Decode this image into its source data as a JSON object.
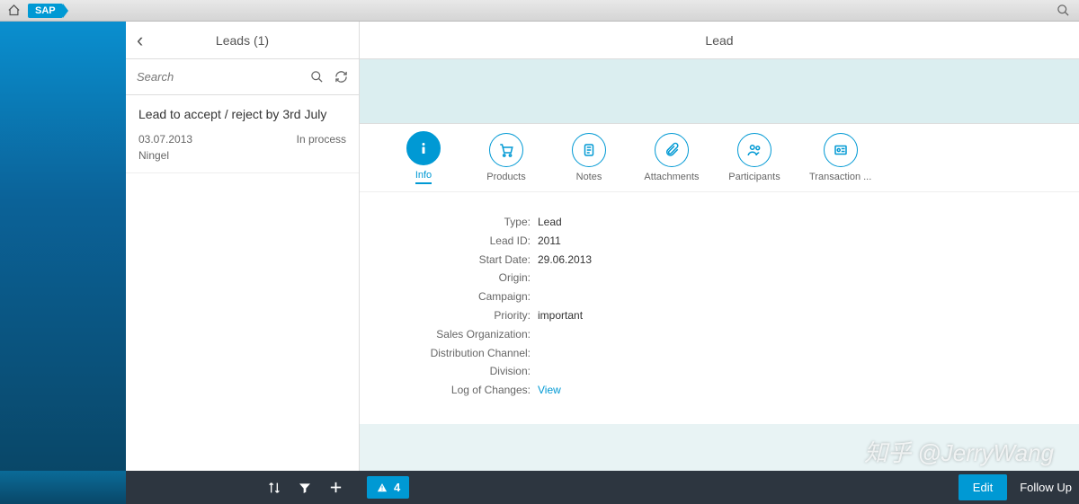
{
  "topbar": {
    "logo": "SAP"
  },
  "master": {
    "title": "Leads (1)",
    "search_placeholder": "Search",
    "item": {
      "title": "Lead to accept / reject by 3rd July",
      "date": "03.07.2013",
      "status": "In process",
      "owner": "Ningel"
    }
  },
  "detail": {
    "title": "Lead",
    "tabs": {
      "info": "Info",
      "products": "Products",
      "notes": "Notes",
      "attachments": "Attachments",
      "participants": "Participants",
      "transaction": "Transaction ..."
    },
    "info": {
      "labels": {
        "type": "Type:",
        "lead_id": "Lead ID:",
        "start_date": "Start Date:",
        "origin": "Origin:",
        "campaign": "Campaign:",
        "priority": "Priority:",
        "sales_org": "Sales Organization:",
        "dist_channel": "Distribution Channel:",
        "division": "Division:",
        "log": "Log of Changes:"
      },
      "values": {
        "type": "Lead",
        "lead_id": "2011",
        "start_date": "29.06.2013",
        "origin": "",
        "campaign": "",
        "priority": "important",
        "sales_org": "",
        "dist_channel": "",
        "division": "",
        "log": "View"
      }
    }
  },
  "footer": {
    "alert_count": "4",
    "edit": "Edit",
    "follow_up": "Follow Up"
  },
  "watermark": "知乎 @JerryWang"
}
